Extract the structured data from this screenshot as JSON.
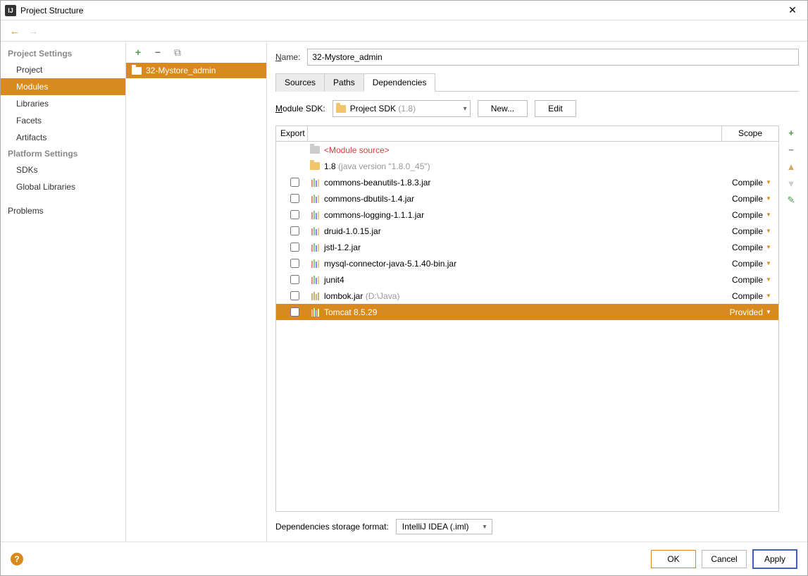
{
  "window": {
    "title": "Project Structure",
    "close": "✕",
    "app_icon_text": "IJ"
  },
  "nav": {
    "back": "←",
    "forward": "→"
  },
  "sidebar": {
    "section_project": "Project Settings",
    "project": "Project",
    "modules": "Modules",
    "libraries": "Libraries",
    "facets": "Facets",
    "artifacts": "Artifacts",
    "section_platform": "Platform Settings",
    "sdks": "SDKs",
    "global_libs": "Global Libraries",
    "problems": "Problems"
  },
  "tree": {
    "toolbar": {
      "plus": "+",
      "minus": "−",
      "copy": "⧉"
    },
    "module_name": "32-Mystore_admin"
  },
  "detail": {
    "name_label_pre": "N",
    "name_label_post": "ame:",
    "name_value": "32-Mystore_admin",
    "tabs": {
      "sources": "Sources",
      "paths": "Paths",
      "dependencies": "Dependencies"
    },
    "sdk_label_pre": "M",
    "sdk_label_post": "odule SDK:",
    "sdk_value": "Project SDK",
    "sdk_value_detail": "(1.8)",
    "new_btn": "New...",
    "edit_btn": "Edit",
    "columns": {
      "export": "Export",
      "scope": "Scope"
    },
    "rows": {
      "module_source": "<Module source>",
      "jdk_name": "1.8",
      "jdk_detail": "(java version \"1.8.0_45\")",
      "r0": {
        "name": "commons-beanutils-1.8.3.jar",
        "scope": "Compile"
      },
      "r1": {
        "name": "commons-dbutils-1.4.jar",
        "scope": "Compile"
      },
      "r2": {
        "name": "commons-logging-1.1.1.jar",
        "scope": "Compile"
      },
      "r3": {
        "name": "druid-1.0.15.jar",
        "scope": "Compile"
      },
      "r4": {
        "name": "jstl-1.2.jar",
        "scope": "Compile"
      },
      "r5": {
        "name": "mysql-connector-java-5.1.40-bin.jar",
        "scope": "Compile"
      },
      "r6": {
        "name": "junit4",
        "scope": "Compile"
      },
      "r7": {
        "name": "lombok.jar",
        "detail": "(D:\\Java)",
        "scope": "Compile"
      },
      "r8": {
        "name": "Tomcat 8.5.29",
        "scope": "Provided"
      }
    },
    "side_tools": {
      "plus": "+",
      "minus": "−",
      "up": "▲",
      "down": "▼",
      "edit": "✎"
    },
    "storage_label": "Dependencies storage format:",
    "storage_value": "IntelliJ IDEA (.iml)"
  },
  "footer": {
    "help": "?",
    "ok": "OK",
    "cancel": "Cancel",
    "apply": "Apply"
  }
}
